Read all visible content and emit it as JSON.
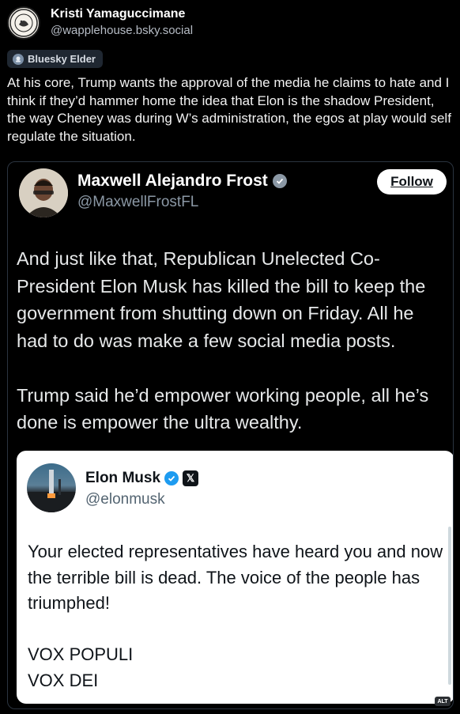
{
  "post": {
    "author": {
      "display_name": "Kristi Yamaguccimane",
      "handle": "@wapplehouse.bsky.social"
    },
    "badge": "Bluesky Elder",
    "text": "At his core, Trump wants the approval of the media he claims to hate and I think if they’d hammer home the idea that Elon is the shadow President, the way Cheney was during W’s administration, the egos at play would self regulate the situation."
  },
  "quote": {
    "author": {
      "display_name": "Maxwell Alejandro Frost",
      "handle": "@MaxwellFrostFL"
    },
    "follow_label": "Follow",
    "text": "And just like that, Republican Unelected Co-President Elon Musk has killed the bill to keep the government from shutting down on Friday. All he had to do was make a few social media posts.\n\nTrump said he’d empower working people, all he’s done is empower the ultra wealthy.",
    "embed": {
      "author": {
        "display_name": "Elon Musk",
        "handle": "@elonmusk"
      },
      "text": "Your elected representatives have heard you and now the terrible bill is dead. The voice of the people has triumphed!\n\nVOX POPULI\nVOX DEI"
    }
  },
  "alt_badge": "ALT",
  "icons": {
    "author_avatar": "seal-avatar",
    "badge": "bluesky-elder-icon",
    "verified": "verified-check-icon",
    "x_logo": "x-logo-icon"
  },
  "colors": {
    "background": "#000000",
    "verified_blue": "#1d9bf0",
    "handle_gray": "#8b98a5"
  }
}
